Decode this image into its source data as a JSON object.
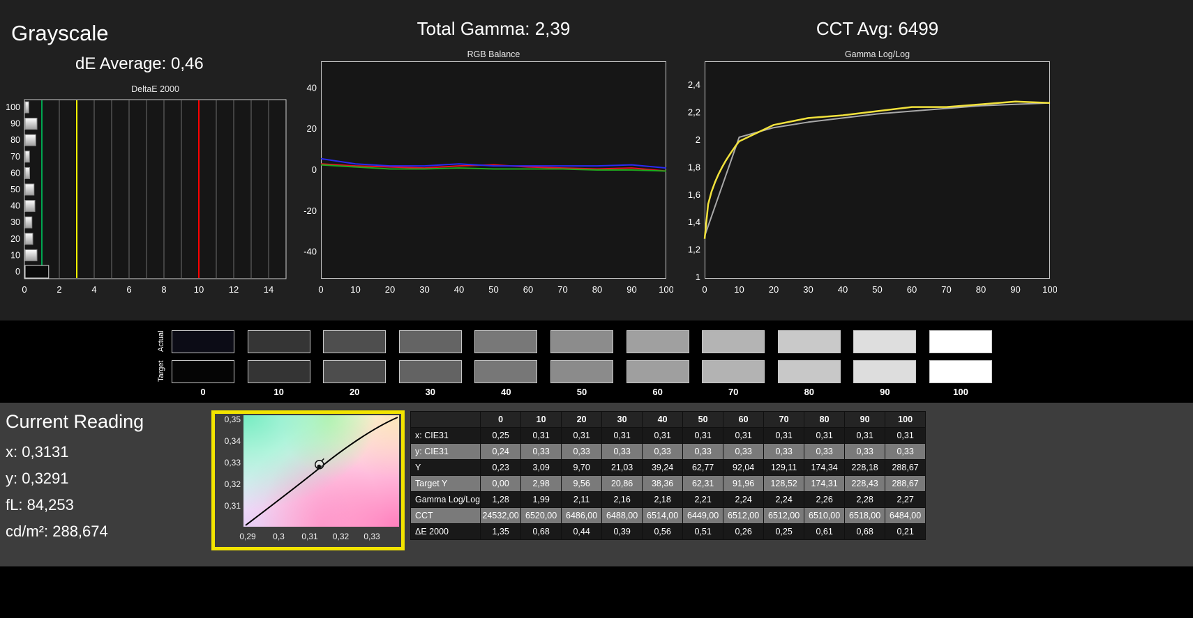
{
  "header": {
    "grayscale_title": "Grayscale",
    "de_average": "dE Average: 0,46",
    "total_gamma_title": "Total Gamma: 2,39",
    "cct_avg_title": "CCT Avg: 6499"
  },
  "chart_data": [
    {
      "type": "bar",
      "orientation": "horizontal",
      "title": "DeltaE 2000",
      "categories": [
        0,
        10,
        20,
        30,
        40,
        50,
        60,
        70,
        80,
        90,
        100
      ],
      "values": [
        1.35,
        0.68,
        0.44,
        0.39,
        0.56,
        0.51,
        0.26,
        0.25,
        0.61,
        0.68,
        0.21
      ],
      "xlim": [
        0,
        15
      ],
      "x_ticks": [
        0,
        2,
        4,
        6,
        8,
        10,
        12,
        14
      ],
      "grid_x_step": 1,
      "reference_lines": [
        {
          "v": 1,
          "color": "#00a650"
        },
        {
          "v": 3,
          "color": "#ffff00"
        },
        {
          "v": 10,
          "color": "#ff0000"
        }
      ]
    },
    {
      "type": "line",
      "title": "RGB Balance",
      "x": [
        0,
        10,
        20,
        30,
        40,
        50,
        60,
        70,
        80,
        90,
        100
      ],
      "x_ticks": [
        0,
        10,
        20,
        30,
        40,
        50,
        60,
        70,
        80,
        90,
        100
      ],
      "ylim": [
        -50,
        50
      ],
      "y_ticks": [
        {
          "label": "40",
          "v": 40
        },
        {
          "label": "20",
          "v": 20
        },
        {
          "label": "0",
          "v": 0
        },
        {
          "label": "-20",
          "v": -20
        },
        {
          "label": "-40",
          "v": -40
        }
      ],
      "series": [
        {
          "name": "red",
          "color": "#e81123",
          "values": [
            3,
            2,
            1.5,
            1,
            2,
            2.5,
            1.5,
            1,
            0.5,
            1,
            -0.5
          ]
        },
        {
          "name": "green",
          "color": "#1daa1d",
          "values": [
            2.5,
            1.5,
            0.5,
            0.5,
            1,
            0.5,
            0.5,
            0.5,
            0,
            0,
            -0.5
          ]
        },
        {
          "name": "blue",
          "color": "#2a2af0",
          "values": [
            5.5,
            3,
            2,
            2,
            3,
            2,
            2,
            2,
            2,
            2.5,
            1
          ]
        }
      ]
    },
    {
      "type": "line",
      "title": "Gamma Log/Log",
      "x": [
        0,
        10,
        20,
        30,
        40,
        50,
        60,
        70,
        80,
        90,
        100
      ],
      "x_ticks": [
        0,
        10,
        20,
        30,
        40,
        50,
        60,
        70,
        80,
        90,
        100
      ],
      "ylim": [
        1,
        2.5
      ],
      "y_ticks": [
        {
          "label": "2,4",
          "v": 2.4
        },
        {
          "label": "2,2",
          "v": 2.2
        },
        {
          "label": "2",
          "v": 2
        },
        {
          "label": "1,8",
          "v": 1.8
        },
        {
          "label": "1,6",
          "v": 1.6
        },
        {
          "label": "1,4",
          "v": 1.4
        },
        {
          "label": "1,2",
          "v": 1.2
        },
        {
          "label": "1",
          "v": 1
        }
      ],
      "series": [
        {
          "name": "reference",
          "color": "#a8a8a8",
          "values": [
            1.3,
            2.02,
            2.09,
            2.13,
            2.16,
            2.19,
            2.21,
            2.23,
            2.25,
            2.26,
            2.27
          ]
        },
        {
          "name": "gamma-measured",
          "color": "#f2e23c",
          "smooth_start": true,
          "values": [
            1.28,
            1.99,
            2.11,
            2.16,
            2.18,
            2.21,
            2.24,
            2.24,
            2.26,
            2.28,
            2.27
          ]
        }
      ]
    },
    {
      "type": "scatter",
      "title": "",
      "x_ticks": [
        "0,29",
        "0,3",
        "0,31",
        "0,32",
        "0,33"
      ],
      "y_ticks": [
        "0,35",
        "0,34",
        "0,33",
        "0,32",
        "0,31"
      ],
      "xlim": [
        0.288,
        0.339
      ],
      "ylim": [
        0.3,
        0.353
      ],
      "points": [
        {
          "x": 0.3131,
          "y": 0.3291,
          "name": "current-reading"
        }
      ]
    }
  ],
  "swatches": {
    "actual_label": "Actual",
    "target_label": "Target",
    "levels": [
      "0",
      "10",
      "20",
      "30",
      "40",
      "50",
      "60",
      "70",
      "80",
      "90",
      "100"
    ],
    "actual_colors": [
      "#0c0c16",
      "#353535",
      "#4e4e4e",
      "#646464",
      "#787878",
      "#8c8c8c",
      "#a0a0a0",
      "#b4b4b4",
      "#c9c9c9",
      "#dedede",
      "#ffffff"
    ],
    "target_colors": [
      "#050505",
      "#343434",
      "#4d4d4d",
      "#636363",
      "#777777",
      "#8b8b8b",
      "#9f9f9f",
      "#b3b3b3",
      "#c8c8c8",
      "#dddddd",
      "#ffffff"
    ]
  },
  "current_reading": {
    "title": "Current Reading",
    "x_label": "x: 0,3131",
    "y_label": "y: 0,3291",
    "fl_label": "fL: 84,253",
    "cdm2_label": "cd/m²: 288,674"
  },
  "table": {
    "header": [
      "0",
      "10",
      "20",
      "30",
      "40",
      "50",
      "60",
      "70",
      "80",
      "90",
      "100"
    ],
    "rows": [
      {
        "label": "x: CIE31",
        "values": [
          "0,25",
          "0,31",
          "0,31",
          "0,31",
          "0,31",
          "0,31",
          "0,31",
          "0,31",
          "0,31",
          "0,31",
          "0,31"
        ]
      },
      {
        "label": "y: CIE31",
        "values": [
          "0,24",
          "0,33",
          "0,33",
          "0,33",
          "0,33",
          "0,33",
          "0,33",
          "0,33",
          "0,33",
          "0,33",
          "0,33"
        ]
      },
      {
        "label": "Y",
        "values": [
          "0,23",
          "3,09",
          "9,70",
          "21,03",
          "39,24",
          "62,77",
          "92,04",
          "129,11",
          "174,34",
          "228,18",
          "288,67"
        ]
      },
      {
        "label": "Target Y",
        "values": [
          "0,00",
          "2,98",
          "9,56",
          "20,86",
          "38,36",
          "62,31",
          "91,96",
          "128,52",
          "174,31",
          "228,43",
          "288,67"
        ]
      },
      {
        "label": "Gamma Log/Log",
        "values": [
          "1,28",
          "1,99",
          "2,11",
          "2,16",
          "2,18",
          "2,21",
          "2,24",
          "2,24",
          "2,26",
          "2,28",
          "2,27"
        ]
      },
      {
        "label": "CCT",
        "values": [
          "24532,00",
          "6520,00",
          "6486,00",
          "6488,00",
          "6514,00",
          "6449,00",
          "6512,00",
          "6512,00",
          "6510,00",
          "6518,00",
          "6484,00"
        ]
      },
      {
        "label": "ΔE 2000",
        "values": [
          "1,35",
          "0,68",
          "0,44",
          "0,39",
          "0,56",
          "0,51",
          "0,26",
          "0,25",
          "0,61",
          "0,68",
          "0,21"
        ]
      }
    ]
  },
  "colors": {
    "cie_frame": "#f2e400",
    "top_panel_bg": "#202020",
    "strip_bg": "#000000",
    "bottom_panel_bg": "#3d3d3d"
  }
}
